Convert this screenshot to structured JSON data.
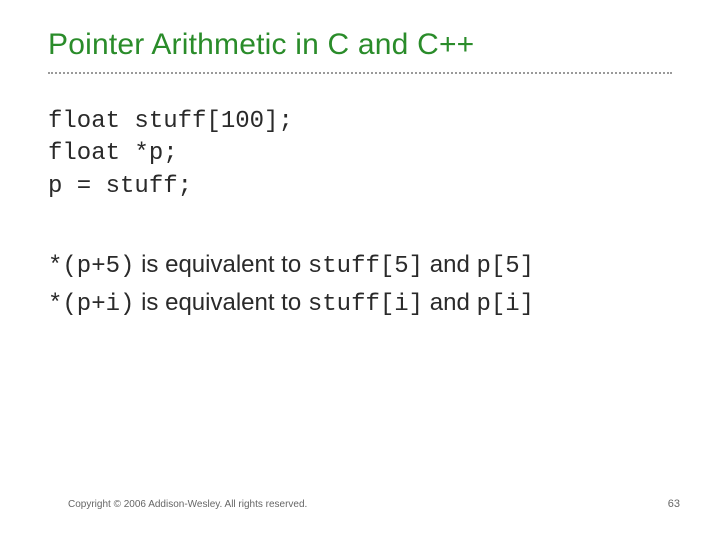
{
  "title": "Pointer Arithmetic in C and C++",
  "code": {
    "line1": "float stuff[100];",
    "line2": "float *p;",
    "line3": "p = stuff;"
  },
  "equiv": {
    "row1": {
      "lhs": "*(p+5)",
      "mid": " is equivalent to ",
      "rhs1": "stuff[5]",
      "and": " and ",
      "rhs2": "p[5]"
    },
    "row2": {
      "lhs": "*(p+i)",
      "mid": " is equivalent to ",
      "rhs1": "stuff[i]",
      "and": " and ",
      "rhs2": "p[i]"
    }
  },
  "footer": {
    "copyright": "Copyright © 2006 Addison-Wesley. All rights reserved.",
    "page": "63"
  }
}
